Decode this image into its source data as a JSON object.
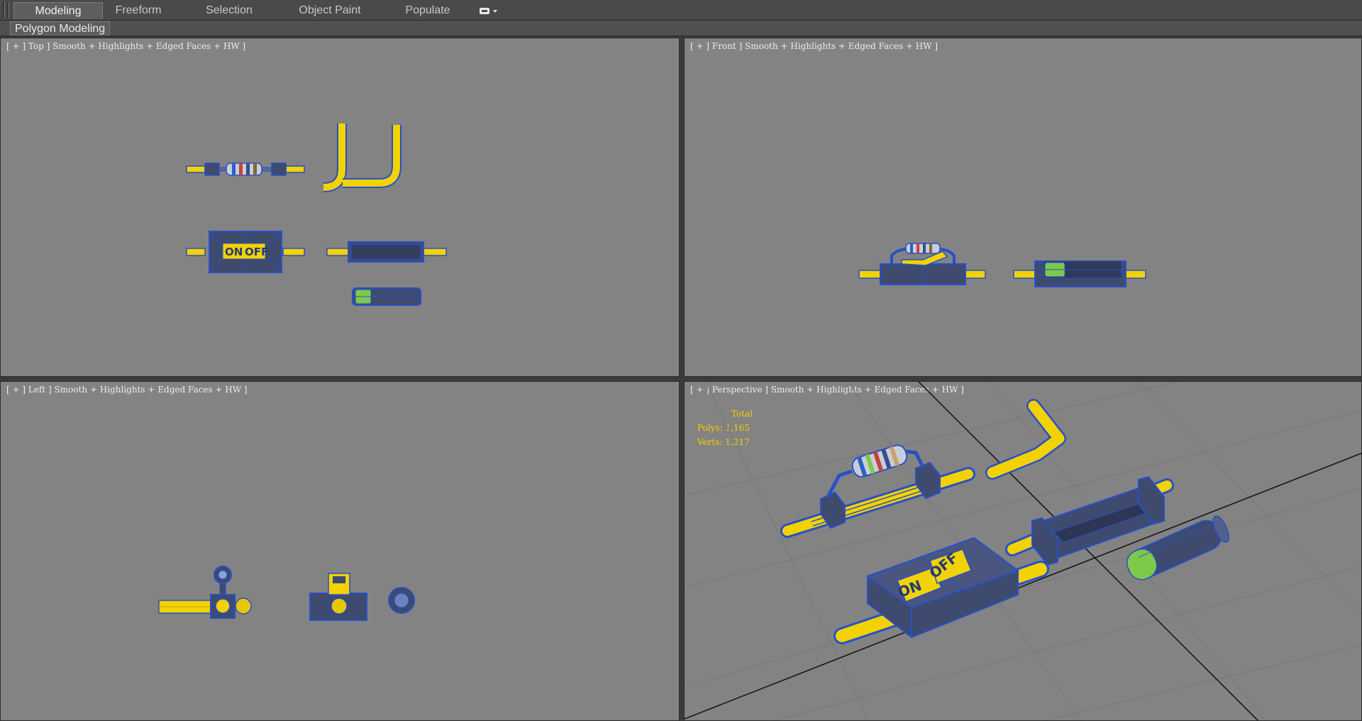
{
  "ribbon": {
    "tabs": [
      {
        "label": "Modeling",
        "active": true
      },
      {
        "label": "Freeform",
        "active": false
      },
      {
        "label": "Selection",
        "active": false
      },
      {
        "label": "Object Paint",
        "active": false
      },
      {
        "label": "Populate",
        "active": false
      }
    ],
    "toggle_icon": "ribbon-display-icon",
    "sub_panel": "Polygon Modeling"
  },
  "viewports": {
    "top": {
      "label": "[ + ] Top ] Smooth + Highlights + Edged Faces + HW ]"
    },
    "front": {
      "label": "[ + ] Front ] Smooth + Highlights + Edged Faces + HW ]"
    },
    "left": {
      "label": "[ + ] Left ] Smooth + Highlights + Edged Faces + HW ]"
    },
    "perspective": {
      "label": "[ + ] Perspective ] Smooth + Highlights + Edged Faces + HW ]",
      "stats": {
        "heading": "Total",
        "polys_label": "Polys:",
        "polys_value": "1,165",
        "verts_label": "Verts:",
        "verts_value": "1,217"
      }
    }
  },
  "switch_labels": {
    "on": "ON",
    "off": "OFF"
  },
  "colors": {
    "viewport_bg": "#838383",
    "wire": "#f2d200",
    "component_body": "#3e4a6e",
    "edge": "#2850c8",
    "stat_text": "#f2d200",
    "battery_band": "#7ec84a"
  }
}
